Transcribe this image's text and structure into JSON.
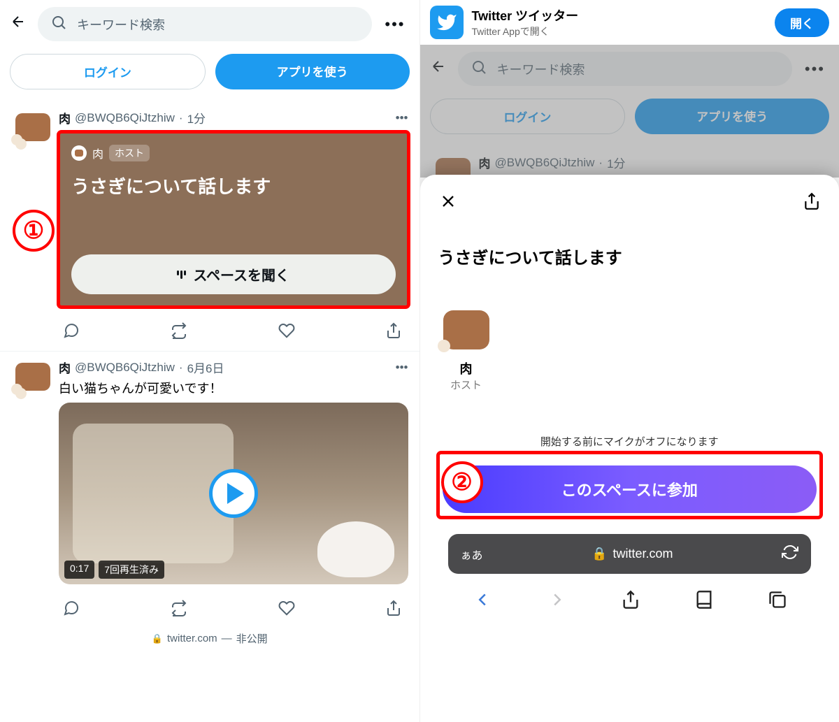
{
  "left": {
    "search_placeholder": "キーワード検索",
    "login_label": "ログイン",
    "use_app_label": "アプリを使う",
    "tweet1": {
      "name": "肉",
      "handle": "@BWQB6QiJtzhiw",
      "time": "1分",
      "space": {
        "host_name": "肉",
        "host_badge": "ホスト",
        "title": "うさぎについて話します",
        "listen_label": "スペースを聞く"
      }
    },
    "tweet2": {
      "name": "肉",
      "handle": "@BWQB6QiJtzhiw",
      "time": "6月6日",
      "text": "白い猫ちゃんが可愛いです！",
      "video": {
        "duration": "0:17",
        "views": "7回再生済み"
      }
    },
    "footer_domain": "twitter.com",
    "footer_privacy": "非公開",
    "annotation": "①"
  },
  "right": {
    "banner": {
      "title": "Twitter ツイッター",
      "subtitle": "Twitter Appで開く",
      "open_label": "開く"
    },
    "search_placeholder": "キーワード検索",
    "login_label": "ログイン",
    "use_app_label": "アプリを使う",
    "peek_name": "肉",
    "peek_handle": "@BWQB6QiJtzhiw",
    "peek_time": "1分",
    "sheet": {
      "title": "うさぎについて話します",
      "host_name": "肉",
      "host_role": "ホスト",
      "mic_note": "開始する前にマイクがオフになります",
      "join_label": "このスペースに参加"
    },
    "url_bar": {
      "aa": "ぁあ",
      "domain": "twitter.com"
    },
    "annotation": "②"
  }
}
